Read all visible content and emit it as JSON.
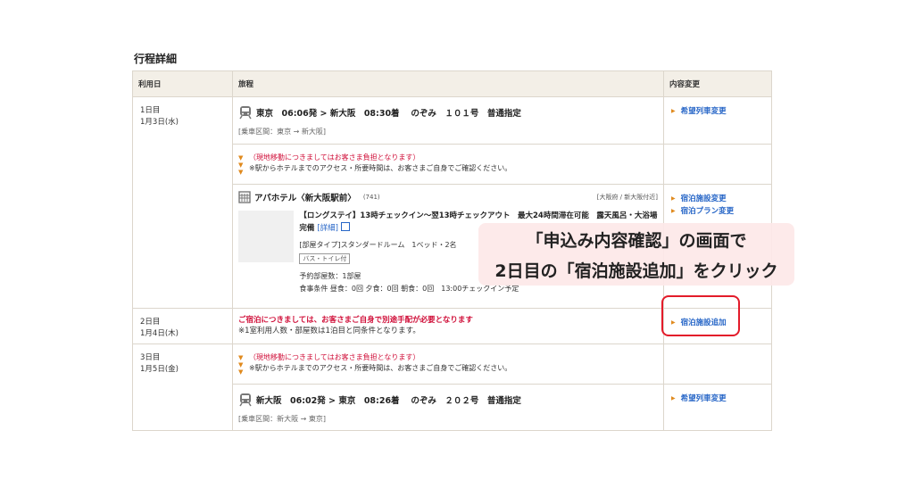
{
  "section_title": "行程詳細",
  "headers": {
    "date": "利用日",
    "trip": "旅程",
    "change": "内容変更"
  },
  "day1": {
    "label": "1日目",
    "date": "1月3日(水)",
    "train": {
      "text": "東京　06:06発 > 新大阪　08:30着　 のぞみ　１０１号　普通指定",
      "route": "[乗車区間：東京 → 新大阪]",
      "change_link": "希望列車変更"
    },
    "notice": {
      "red": "（現地移動につきましてはお客さま負担となります）",
      "black": "※駅からホテルまでのアクセス・所要時間は、お客さまご自身でご確認ください。"
    },
    "hotel": {
      "name": "アパホテル〈新大阪駅前〉",
      "code": "(741)",
      "area": "[大阪府 / 新大阪付近]",
      "plan_title": "【ロングステイ】13時チェックイン〜翌13時チェックアウト　最大24時間滞在可能　露天風呂・大浴場完備",
      "detail_link": "[詳細]",
      "room_type": "[部屋タイプ]スタンダードルーム　1ベッド・2名",
      "badge": "バス・トイレ付",
      "rooms": "予約部屋数：1部屋",
      "meals": "食事条件 昼食：0回 夕食：0回 朝食：0回　13:00チェックイン予定",
      "links": [
        "宿泊施設変更",
        "宿泊プラン変更"
      ]
    }
  },
  "day2": {
    "label": "2日目",
    "date": "1月4日(木)",
    "red_notice": "ご宿泊につきましては、お客さまご自身で別途手配が必要となります",
    "note": "※1室利用人数・部屋数は1泊目と同条件となります。",
    "add_link": "宿泊施設追加"
  },
  "day3": {
    "label": "3日目",
    "date": "1月5日(金)",
    "notice": {
      "red": "（現地移動につきましてはお客さま負担となります）",
      "black": "※駅からホテルまでのアクセス・所要時間は、お客さまご自身でご確認ください。"
    },
    "train": {
      "text": "新大阪　06:02発 > 東京　08:26着　 のぞみ　２０２号　普通指定",
      "route": "[乗車区間：新大阪 → 東京]",
      "change_link": "希望列車変更"
    }
  },
  "callout": {
    "line1": "「申込み内容確認」の画面で",
    "line2": "2日目の「宿泊施設追加」をクリック"
  },
  "colors": {
    "accent_link": "#2766c7",
    "notice_red": "#d0103a",
    "arrow_orange": "#e08a1e",
    "highlight_red": "#e31b2a",
    "header_bg": "#f3efe7",
    "callout_bg": "#fde8e8"
  },
  "icons": [
    "train-icon",
    "building-icon",
    "external-link-icon",
    "arrow-right-icon",
    "triangle-down-icon"
  ]
}
